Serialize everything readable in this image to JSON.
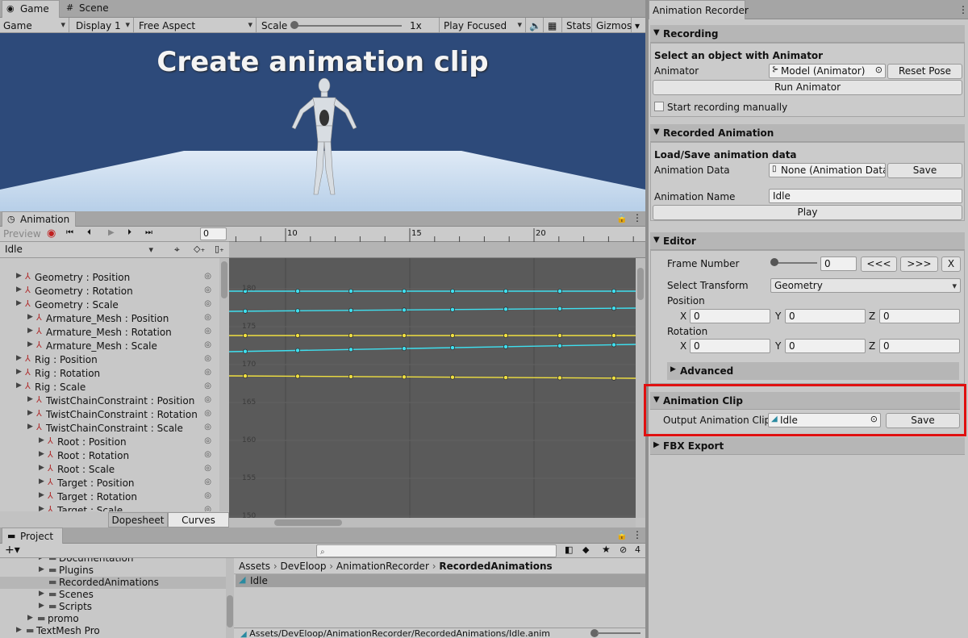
{
  "game_panel": {
    "tabs": [
      {
        "label": "Game"
      },
      {
        "label": "Scene"
      }
    ],
    "toolbar": {
      "view": "Game",
      "display": "Display 1",
      "aspect": "Free Aspect",
      "scale_label": "Scale",
      "scale_value": "1x",
      "play_mode": "Play Focused",
      "stats": "Stats",
      "gizmos": "Gizmos"
    },
    "overlay_title": "Create animation clip"
  },
  "animation_panel": {
    "tab_label": "Animation",
    "preview_label": "Preview",
    "frame_value": "0",
    "clip_name": "Idle",
    "timeline_ticks": [
      "10",
      "15",
      "20"
    ],
    "curve_axis_labels": [
      "180",
      "175",
      "170",
      "165",
      "160",
      "155",
      "150"
    ],
    "properties": [
      {
        "label": "Geometry : Position"
      },
      {
        "label": "Geometry : Rotation"
      },
      {
        "label": "Geometry : Scale"
      },
      {
        "label": "Armature_Mesh : Position"
      },
      {
        "label": "Armature_Mesh : Rotation"
      },
      {
        "label": "Armature_Mesh : Scale"
      },
      {
        "label": "Rig : Position"
      },
      {
        "label": "Rig : Rotation"
      },
      {
        "label": "Rig : Scale"
      },
      {
        "label": "TwistChainConstraint : Position"
      },
      {
        "label": "TwistChainConstraint : Rotation"
      },
      {
        "label": "TwistChainConstraint : Scale"
      },
      {
        "label": "Root : Position"
      },
      {
        "label": "Root : Rotation"
      },
      {
        "label": "Root : Scale"
      },
      {
        "label": "Target : Position"
      },
      {
        "label": "Target : Rotation"
      },
      {
        "label": "Target : Scale"
      }
    ],
    "bottom_tabs": [
      {
        "label": "Dopesheet"
      },
      {
        "label": "Curves"
      }
    ]
  },
  "project_panel": {
    "tab_label": "Project",
    "filter_count": "4",
    "tree": [
      {
        "label": "Documentation"
      },
      {
        "label": "Plugins"
      },
      {
        "label": "RecordedAnimations"
      },
      {
        "label": "Scenes"
      },
      {
        "label": "Scripts"
      },
      {
        "label": "promo"
      },
      {
        "label": "TextMesh Pro"
      }
    ],
    "breadcrumb": [
      "Assets",
      "DevEloop",
      "AnimationRecorder",
      "RecordedAnimations"
    ],
    "assets": [
      {
        "label": "Idle"
      }
    ],
    "status_path": "Assets/DevEloop/AnimationRecorder/RecordedAnimations/Idle.anim"
  },
  "recorder": {
    "tab_label": "Animation Recorder",
    "recording": {
      "header": "Recording",
      "subheader": "Select an object with Animator",
      "animator_label": "Animator",
      "animator_value": "Model (Animator)",
      "reset_pose": "Reset Pose",
      "run_animator": "Run Animator",
      "start_manually": "Start recording manually"
    },
    "recorded": {
      "header": "Recorded Animation",
      "subheader": "Load/Save animation data",
      "data_label": "Animation Data",
      "data_value": "None (Animation Data)",
      "save": "Save",
      "name_label": "Animation Name",
      "name_value": "Idle",
      "play": "Play"
    },
    "editor": {
      "header": "Editor",
      "frame_label": "Frame Number",
      "frame_value": "0",
      "prev": "<<<",
      "next": ">>>",
      "close": "X",
      "select_transform_label": "Select Transform",
      "select_transform_value": "Geometry",
      "position_label": "Position",
      "rotation_label": "Rotation",
      "axis_x": "X",
      "axis_y": "Y",
      "axis_z": "Z",
      "pos": {
        "x": "0",
        "y": "0",
        "z": "0"
      },
      "rot": {
        "x": "0",
        "y": "0",
        "z": "0"
      },
      "advanced": "Advanced"
    },
    "clip": {
      "header": "Animation Clip",
      "output_label": "Output Animation Clip",
      "output_value": "Idle",
      "save": "Save"
    },
    "fbx": {
      "header": "FBX Export"
    }
  },
  "colors": {
    "game_bg": "#2d4a7a",
    "curve_cyan": "#3ee0f0",
    "curve_yellow": "#f0e040",
    "highlight_red": "#e01010"
  }
}
